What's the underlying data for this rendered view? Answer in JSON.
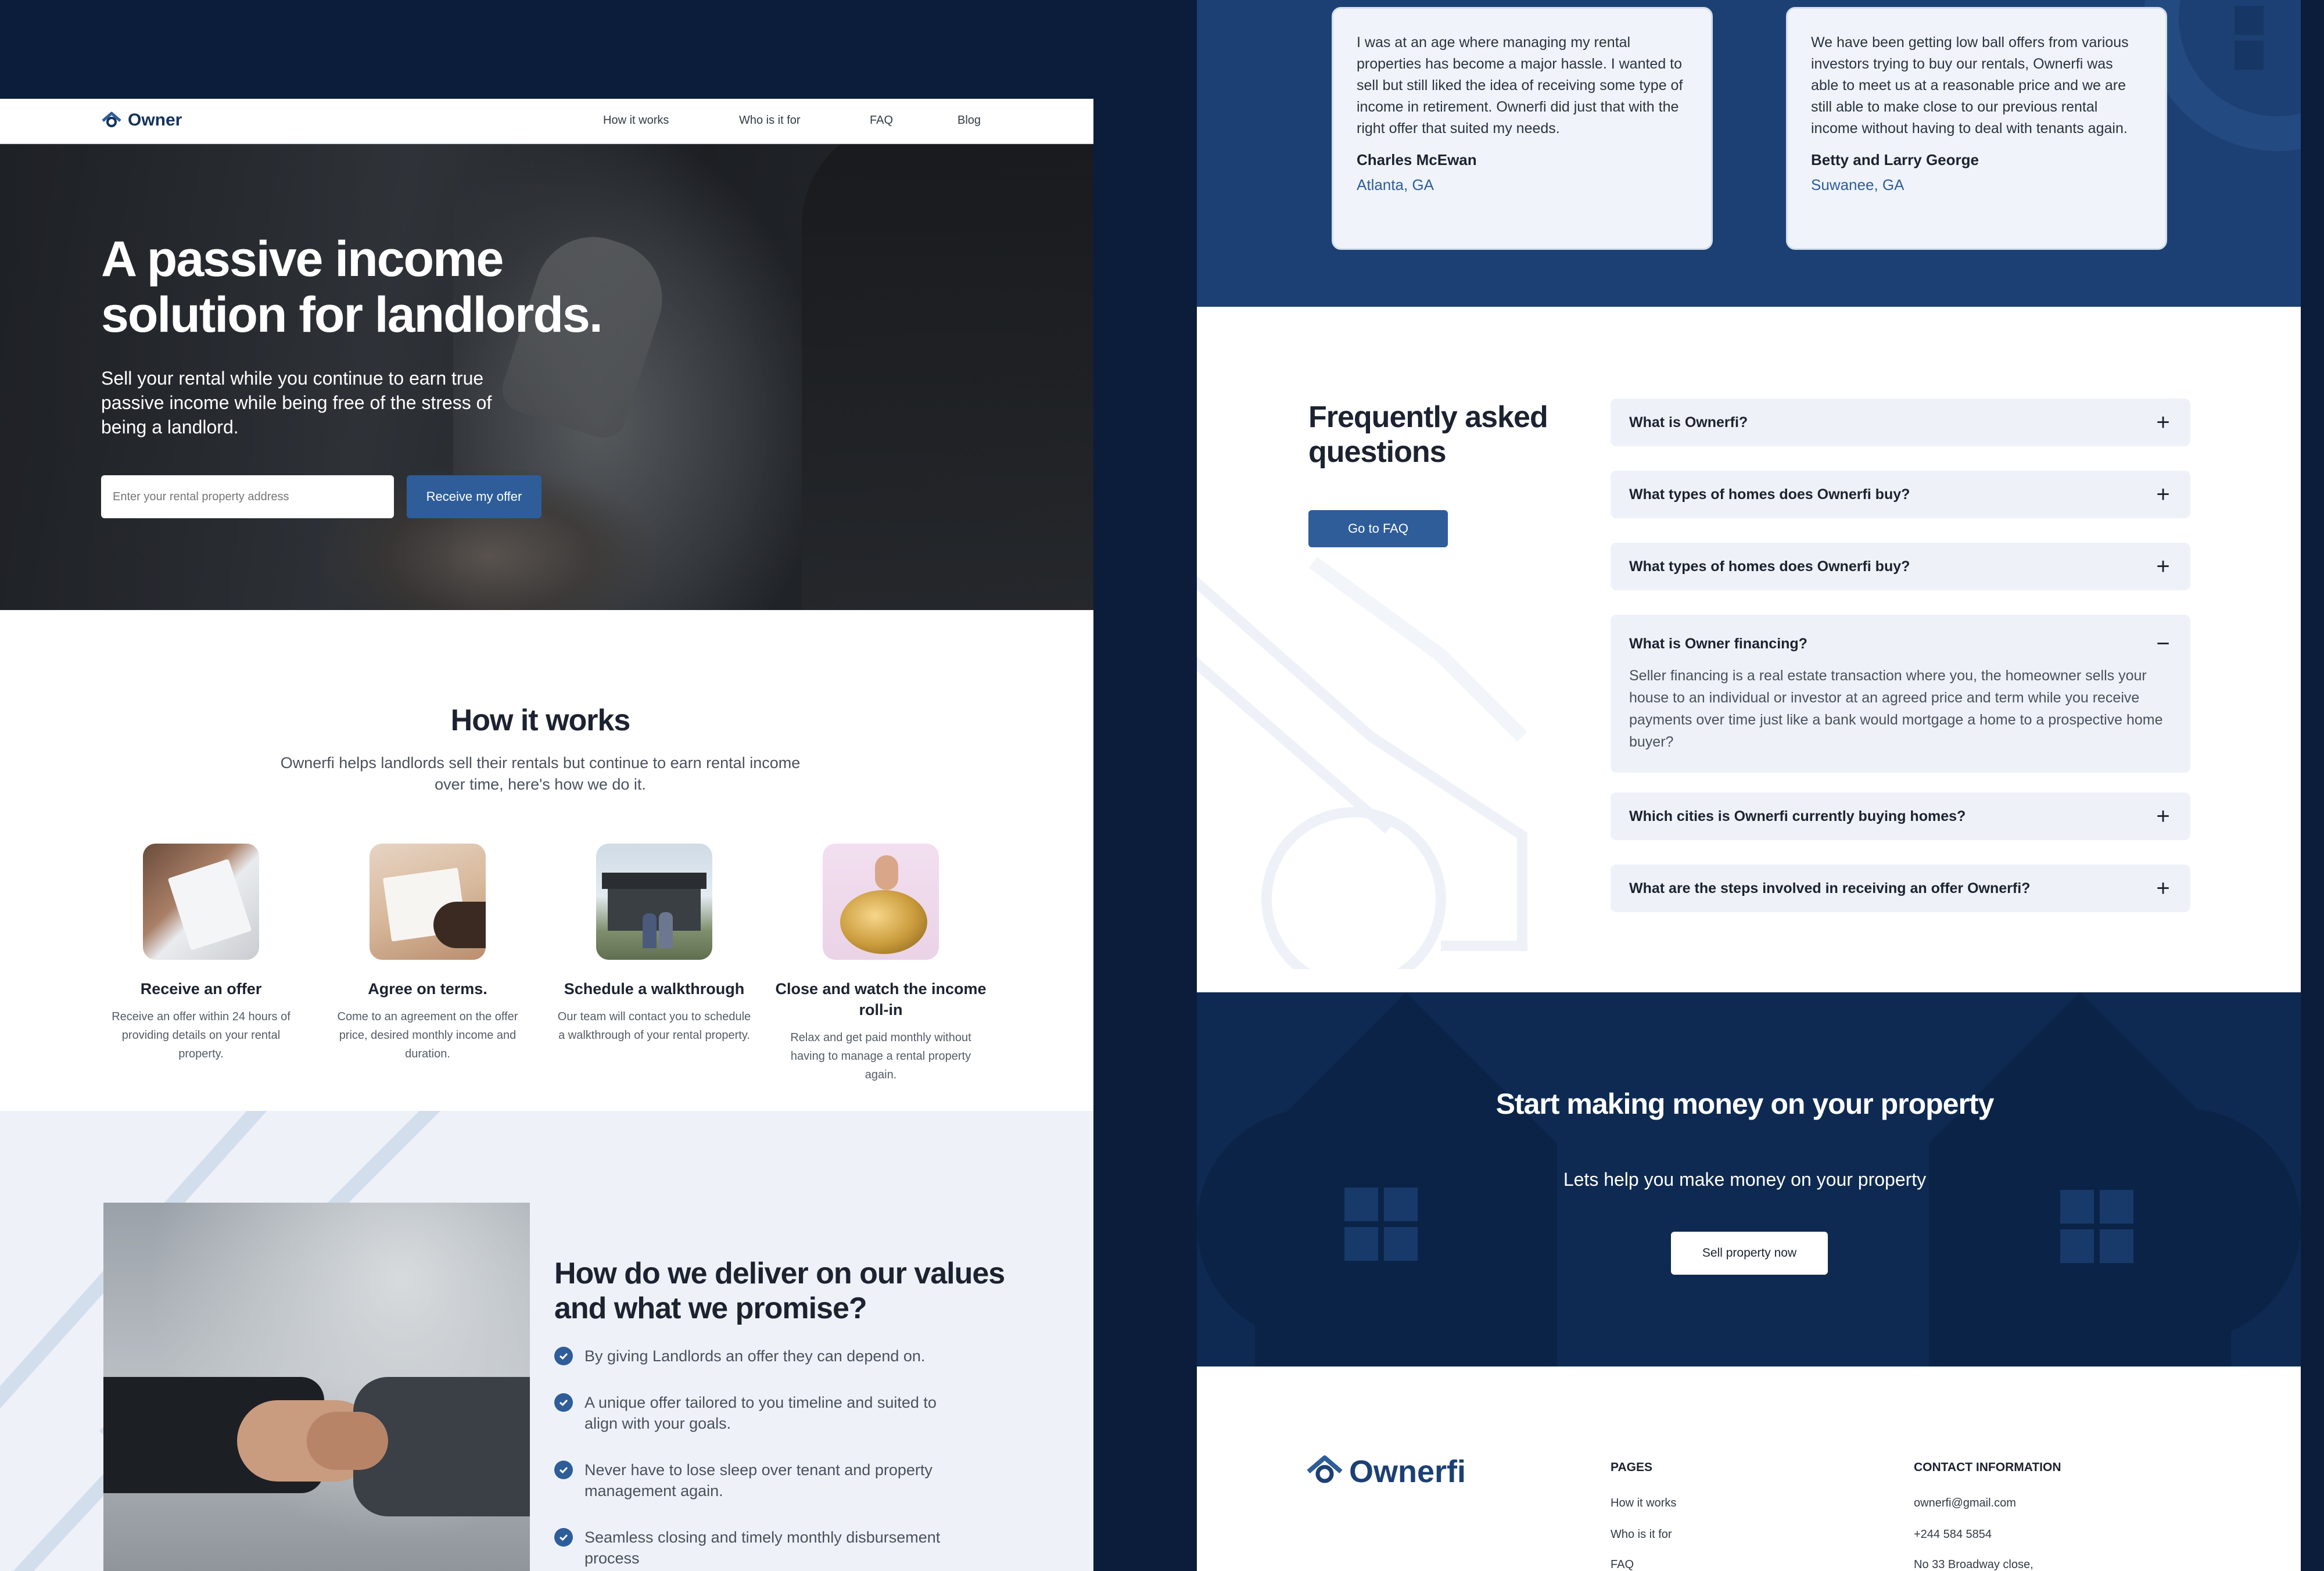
{
  "brand": {
    "name_short": "Owner",
    "name_full": "Ownerfi",
    "accent": "#2e5d9a",
    "navy": "#0b1d3a",
    "dark_blue": "#1c4074"
  },
  "nav": {
    "links": [
      "How it works",
      "Who is it for",
      "FAQ",
      "Blog"
    ]
  },
  "hero": {
    "title": "A passive income solution for landlords.",
    "subtitle": "Sell your rental while you continue to earn true passive income while being free of the stress of being a landlord.",
    "input_placeholder": "Enter your rental property address",
    "button": "Receive my offer"
  },
  "how": {
    "title": "How it works",
    "subtitle": "Ownerfi helps landlords sell their rentals but continue to earn rental income over time, here's how we do it.",
    "steps": [
      {
        "title": "Receive an offer",
        "text": "Receive an offer within 24 hours of providing details on your rental property.",
        "icon": "contract-photo"
      },
      {
        "title": "Agree on terms.",
        "text": "Come to an agreement on the offer price, desired monthly income and duration.",
        "icon": "signing-photo"
      },
      {
        "title": "Schedule a walkthrough",
        "text": "Our team will contact you to schedule a walkthrough of your rental property.",
        "icon": "house-photo"
      },
      {
        "title": "Close and watch the income roll-in",
        "text": "Relax and get paid monthly without having to manage a rental property again.",
        "icon": "piggy-bank-photo"
      }
    ]
  },
  "values": {
    "title": "How do we deliver on our values and what we promise?",
    "bullets": [
      "By giving Landlords an offer they can depend on.",
      "A unique offer tailored to you timeline and suited to align with your goals.",
      "Never have to lose sleep over tenant and property management again.",
      "Seamless closing and timely monthly disbursement process"
    ]
  },
  "testimonials": [
    {
      "quote": "I was at an age where managing my rental properties has become a major hassle. I wanted to sell but still liked the idea of receiving some type of income in retirement. Ownerfi did just that with the right offer that suited my needs.",
      "author": "Charles McEwan",
      "city": "Atlanta, GA"
    },
    {
      "quote": "We have been getting low ball offers from various investors trying to buy our rentals, Ownerfi was able to meet us at a reasonable price and we are still able to make close to our previous rental income without having to deal with tenants again.",
      "author": "Betty and Larry George",
      "city": "Suwanee, GA"
    }
  ],
  "faq": {
    "title": "Frequently asked questions",
    "button": "Go to FAQ",
    "items": [
      {
        "q": "What is Ownerfi?",
        "sign": "+",
        "answer": ""
      },
      {
        "q": "What types of homes does Ownerfi buy?",
        "sign": "+",
        "answer": ""
      },
      {
        "q": "What types of homes does Ownerfi buy?",
        "sign": "+",
        "answer": ""
      },
      {
        "q": "What is Owner financing?",
        "sign": "−",
        "answer": "Seller financing is a real estate transaction where you, the homeowner sells your house to an individual or investor at an agreed price and term while you receive payments over time just like a bank would mortgage a home to a prospective home buyer?"
      },
      {
        "q": "Which cities is Ownerfi currently buying homes?",
        "sign": "+",
        "answer": ""
      },
      {
        "q": "What are the steps involved in receiving an offer Ownerfi?",
        "sign": "+",
        "answer": ""
      }
    ]
  },
  "cta": {
    "title": "Start making money on your property",
    "subtitle": "Lets help you make money on your property",
    "button": "Sell property now"
  },
  "footer": {
    "pages_heading": "PAGES",
    "pages": [
      "How it works",
      "Who is it for",
      "FAQ"
    ],
    "contact_heading": "CONTACT INFORMATION",
    "contact": [
      "ownerfi@gmail.com",
      "+244 584 5854",
      "No 33 Broadway close,"
    ]
  }
}
